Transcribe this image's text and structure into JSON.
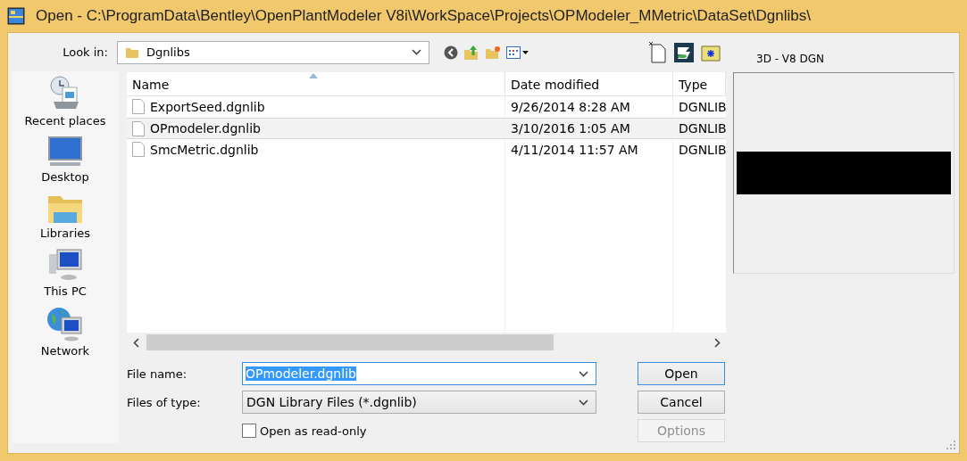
{
  "window": {
    "title": "Open - C:\\ProgramData\\Bentley\\OpenPlantModeler V8i\\WorkSpace\\Projects\\OPModeler_MMetric\\DataSet\\Dgnlibs\\"
  },
  "look_in": {
    "label": "Look in:",
    "value": "Dgnlibs"
  },
  "preview": {
    "label": "3D - V8 DGN"
  },
  "places": [
    {
      "kind": "recent",
      "label": "Recent places"
    },
    {
      "kind": "desktop",
      "label": "Desktop"
    },
    {
      "kind": "libraries",
      "label": "Libraries"
    },
    {
      "kind": "pc",
      "label": "This PC"
    },
    {
      "kind": "network",
      "label": "Network"
    }
  ],
  "file_list": {
    "columns": [
      "Name",
      "Date modified",
      "Type"
    ],
    "rows": [
      {
        "name": "ExportSeed.dgnlib",
        "date": "9/26/2014 8:28 AM",
        "type": "DGNLIB",
        "selected": false
      },
      {
        "name": "OPmodeler.dgnlib",
        "date": "3/10/2016 1:05 AM",
        "type": "DGNLIB",
        "selected": true
      },
      {
        "name": "SmcMetric.dgnlib",
        "date": "4/11/2014 11:57 AM",
        "type": "DGNLIB",
        "selected": false
      }
    ]
  },
  "file_name": {
    "label": "File name:",
    "value": "OPmodeler.dgnlib"
  },
  "file_type": {
    "label": "Files of type:",
    "value": "DGN Library Files (*.dgnlib)"
  },
  "read_only": {
    "label": "Open as read-only",
    "checked": false
  },
  "buttons": [
    {
      "label": "Open",
      "default": true,
      "disabled": false
    },
    {
      "label": "Cancel",
      "default": false,
      "disabled": false
    },
    {
      "label": "Options",
      "default": false,
      "disabled": true
    }
  ]
}
